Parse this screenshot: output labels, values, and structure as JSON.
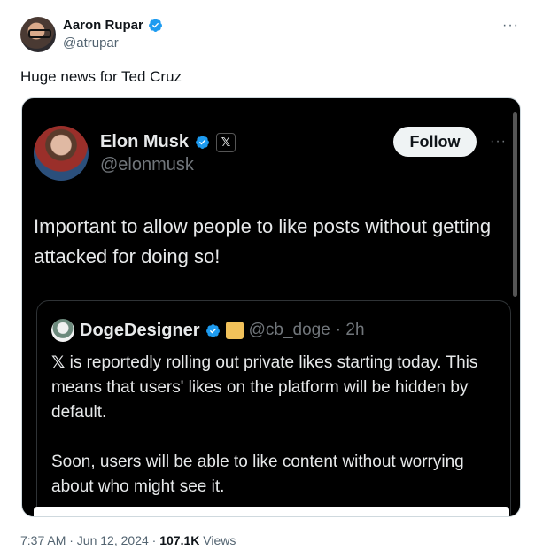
{
  "tweet": {
    "author_name": "Aaron Rupar",
    "author_handle": "@atrupar",
    "text": "Huge news for Ted Cruz",
    "timestamp": "7:37 AM · Jun 12, 2024 ·",
    "views_count": "107.1K",
    "views_label": "Views",
    "more_label": "···"
  },
  "embedded": {
    "author_name": "Elon Musk",
    "author_handle": "@elonmusk",
    "x_badge": "𝕏",
    "follow_label": "Follow",
    "more_label": "···",
    "text": "Important to allow people to like posts without getting attacked for doing so!",
    "quote": {
      "author_name": "DogeDesigner",
      "author_handle": "@cb_doge",
      "time": "· 2h",
      "x_symbol": "𝕏",
      "body": " is reportedly rolling out private likes starting today. This means that users' likes on the platform will be hidden by default.\n\nSoon, users will be able to like content without worrying about who might see it."
    }
  },
  "colors": {
    "verified": "#1d9bf0",
    "card_bg": "#000000",
    "muted": "#536471"
  }
}
